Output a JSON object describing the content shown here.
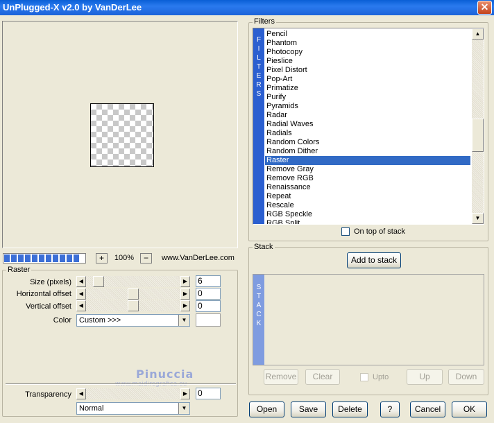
{
  "window": {
    "title": "UnPlugged-X v2.0 by VanDerLee",
    "close_label": "✕"
  },
  "preview": {
    "zoom": "100%",
    "zoom_minus": "−",
    "zoom_plus": "+",
    "website": "www.VanDerLee.com",
    "progress_segments": 11
  },
  "raster": {
    "group_label": "Raster",
    "size": {
      "label": "Size (pixels)",
      "value": "6"
    },
    "hoffset": {
      "label": "Horizontal offset",
      "value": "0"
    },
    "voffset": {
      "label": "Vertical offset",
      "value": "0"
    },
    "color": {
      "label": "Color",
      "value": "Custom >>>"
    }
  },
  "transparency": {
    "label": "Transparency",
    "value": "0",
    "mode": "Normal"
  },
  "watermark": {
    "name": "Pinuccia",
    "url": "www.maidiregrafica.eu"
  },
  "filters": {
    "group_label": "Filters",
    "side_label": [
      "F",
      "I",
      "L",
      "T",
      "E",
      "R",
      "S"
    ],
    "items": [
      "Pencil",
      "Phantom",
      "Photocopy",
      "Pieslice",
      "Pixel Distort",
      "Pop-Art",
      "Primatize",
      "Purify",
      "Pyramids",
      "Radar",
      "Radial Waves",
      "Radials",
      "Random Colors",
      "Random Dither",
      "Raster",
      "Remove Gray",
      "Remove RGB",
      "Renaissance",
      "Repeat",
      "Rescale",
      "RGB Speckle",
      "RGB Split"
    ],
    "selected": "Raster",
    "on_top_label": "On top of stack"
  },
  "stack": {
    "group_label": "Stack",
    "add_label": "Add to stack",
    "side_label": [
      "S",
      "T",
      "A",
      "C",
      "K"
    ],
    "remove_label": "Remove",
    "clear_label": "Clear",
    "upto_label": "Upto",
    "up_label": "Up",
    "down_label": "Down"
  },
  "buttons": {
    "open": "Open",
    "save": "Save",
    "delete": "Delete",
    "help": "?",
    "cancel": "Cancel",
    "ok": "OK"
  },
  "icons": {
    "arrow_left": "◀",
    "arrow_right": "▶",
    "arrow_up": "▲",
    "arrow_down": "▼"
  }
}
